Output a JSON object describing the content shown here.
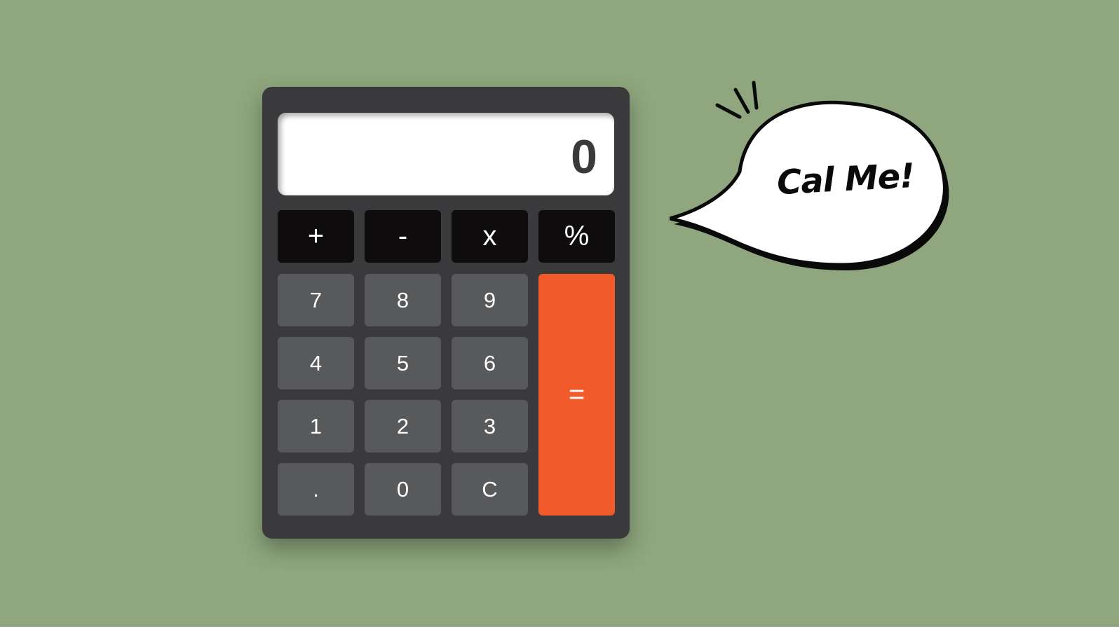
{
  "calculator": {
    "display_value": "0",
    "operators": [
      "+",
      "-",
      "x",
      "%"
    ],
    "keys": {
      "seven": "7",
      "eight": "8",
      "nine": "9",
      "four": "4",
      "five": "5",
      "six": "6",
      "one": "1",
      "two": "2",
      "three": "3",
      "decimal": ".",
      "zero": "0",
      "clear": "C",
      "equals": "="
    }
  },
  "speech_bubble": {
    "text": "Cal Me!"
  },
  "colors": {
    "background": "#8fa67e",
    "calculator_body": "#3a3a3c",
    "operator_key": "#0f0c0d",
    "number_key": "#58595b",
    "equals_key": "#f15a2b",
    "display": "#ffffff"
  }
}
